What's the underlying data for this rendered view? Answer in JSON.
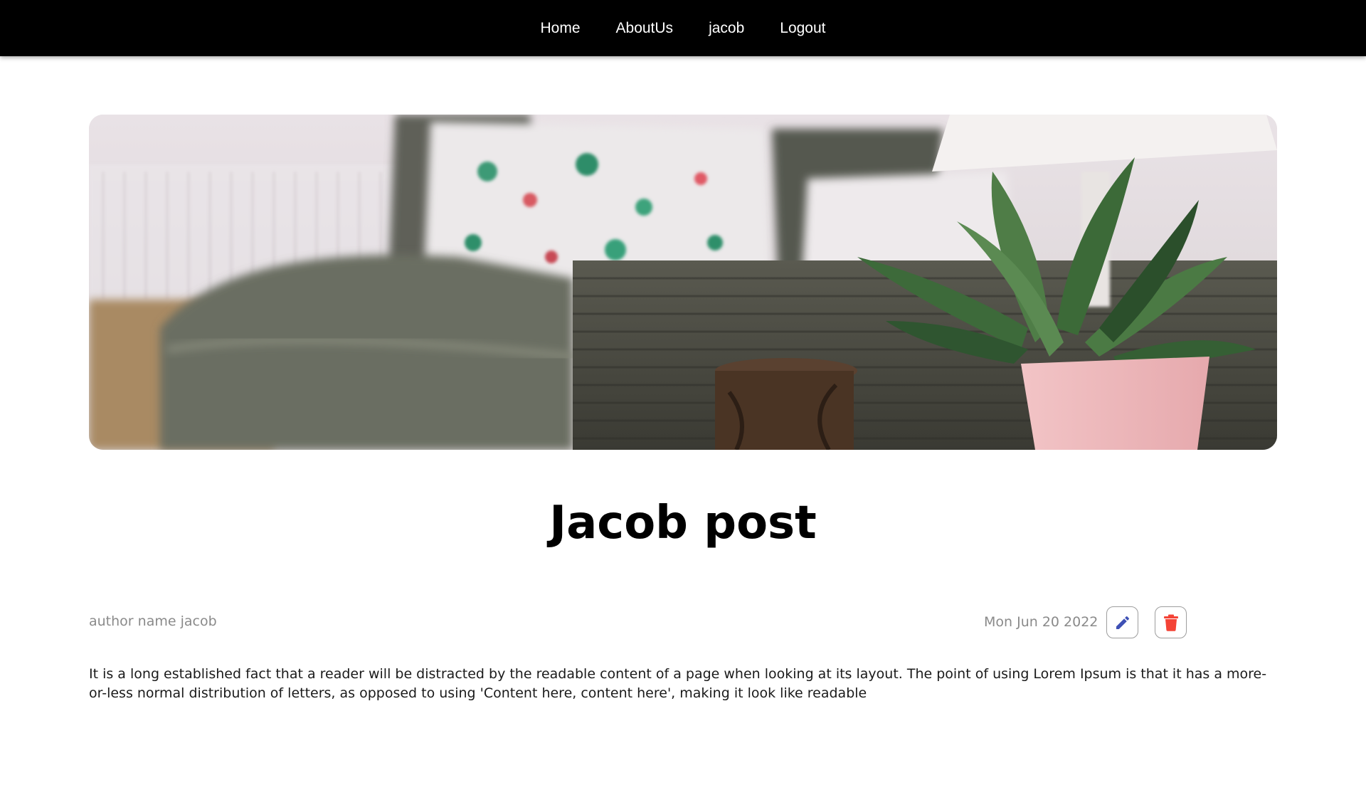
{
  "nav": {
    "items": [
      {
        "label": "Home"
      },
      {
        "label": "AboutUs"
      },
      {
        "label": "jacob"
      },
      {
        "label": "Logout"
      }
    ]
  },
  "post": {
    "title": "Jacob post",
    "author": "author name jacob",
    "date": "Mon Jun 20 2022",
    "body": "It is a long established fact that a reader will be distracted by the readable content of a page when looking at its layout. The point of using Lorem Ipsum is that it has a more-or-less normal distribution of letters, as opposed to using 'Content here, content here', making it look like readable"
  },
  "icons": {
    "edit": "pencil-icon",
    "delete": "trash-icon"
  },
  "colors": {
    "navbar": "#000000",
    "nav_text": "#ffffff",
    "edit_icon": "#3f51b5",
    "delete_icon": "#f44336",
    "meta_text": "#8a8a8a"
  }
}
